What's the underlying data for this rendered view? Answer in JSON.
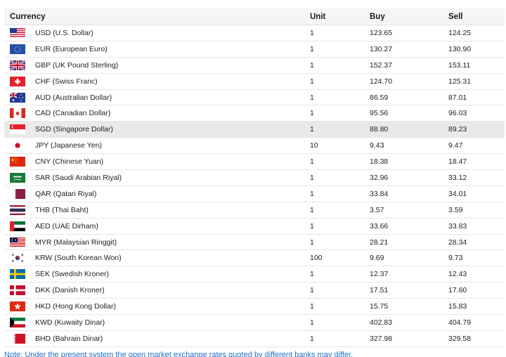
{
  "header": {
    "currency": "Currency",
    "unit": "Unit",
    "buy": "Buy",
    "sell": "Sell"
  },
  "rows": [
    {
      "flag": "us-flag-icon",
      "name": "USD (U.S. Dollar)",
      "unit": "1",
      "buy": "123.65",
      "sell": "124.25"
    },
    {
      "flag": "eu-flag-icon",
      "name": "EUR (European Euro)",
      "unit": "1",
      "buy": "130.27",
      "sell": "130.90"
    },
    {
      "flag": "gb-flag-icon",
      "name": "GBP (UK Pound Sterling)",
      "unit": "1",
      "buy": "152.37",
      "sell": "153.11"
    },
    {
      "flag": "ch-flag-icon",
      "name": "CHF (Swiss Franc)",
      "unit": "1",
      "buy": "124.70",
      "sell": "125.31"
    },
    {
      "flag": "au-flag-icon",
      "name": "AUD (Australian Dollar)",
      "unit": "1",
      "buy": "86.59",
      "sell": "87.01"
    },
    {
      "flag": "ca-flag-icon",
      "name": "CAD (Canadian Dollar)",
      "unit": "1",
      "buy": "95.56",
      "sell": "96.03"
    },
    {
      "flag": "sg-flag-icon",
      "name": "SGD (Singapore Dollar)",
      "unit": "1",
      "buy": "88.80",
      "sell": "89.23"
    },
    {
      "flag": "jp-flag-icon",
      "name": "JPY (Japanese Yen)",
      "unit": "10",
      "buy": "9.43",
      "sell": "9.47"
    },
    {
      "flag": "cn-flag-icon",
      "name": "CNY (Chinese Yuan)",
      "unit": "1",
      "buy": "18.38",
      "sell": "18.47"
    },
    {
      "flag": "sa-flag-icon",
      "name": "SAR (Saudi Arabian Riyal)",
      "unit": "1",
      "buy": "32.96",
      "sell": "33.12"
    },
    {
      "flag": "qa-flag-icon",
      "name": "QAR (Qatari Riyal)",
      "unit": "1",
      "buy": "33.84",
      "sell": "34.01"
    },
    {
      "flag": "th-flag-icon",
      "name": "THB (Thai Baht)",
      "unit": "1",
      "buy": "3.57",
      "sell": "3.59"
    },
    {
      "flag": "ae-flag-icon",
      "name": "AED (UAE Dirham)",
      "unit": "1",
      "buy": "33.66",
      "sell": "33.83"
    },
    {
      "flag": "my-flag-icon",
      "name": "MYR (Malaysian Ringgit)",
      "unit": "1",
      "buy": "28.21",
      "sell": "28.34"
    },
    {
      "flag": "kr-flag-icon",
      "name": "KRW (South Korean Won)",
      "unit": "100",
      "buy": "9.69",
      "sell": "9.73"
    },
    {
      "flag": "se-flag-icon",
      "name": "SEK (Swedish Kroner)",
      "unit": "1",
      "buy": "12.37",
      "sell": "12.43"
    },
    {
      "flag": "dk-flag-icon",
      "name": "DKK (Danish Kroner)",
      "unit": "1",
      "buy": "17.51",
      "sell": "17.60"
    },
    {
      "flag": "hk-flag-icon",
      "name": "HKD (Hong Kong Dollar)",
      "unit": "1",
      "buy": "15.75",
      "sell": "15.83"
    },
    {
      "flag": "kw-flag-icon",
      "name": "KWD (Kuwaity Dinar)",
      "unit": "1",
      "buy": "402.83",
      "sell": "404.79"
    },
    {
      "flag": "bh-flag-icon",
      "name": "BHD (Bahrain Dinar)",
      "unit": "1",
      "buy": "327.98",
      "sell": "329.58"
    }
  ],
  "note": "Note: Under the present system the open market exchange rates quoted by different banks may differ."
}
